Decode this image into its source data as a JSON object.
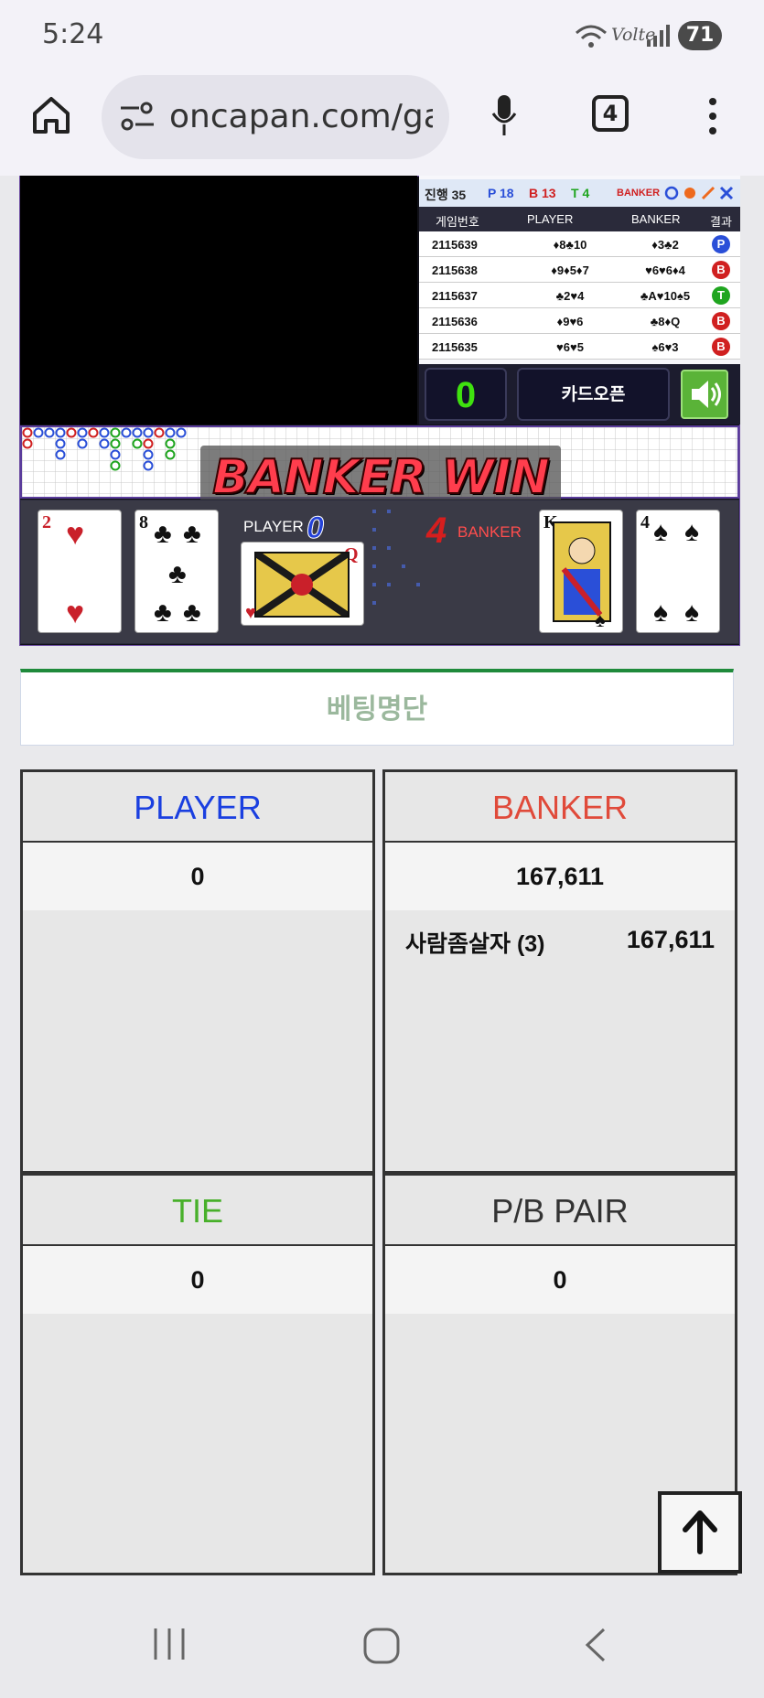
{
  "status_bar": {
    "time": "5:24",
    "network": "Volte",
    "battery": "71"
  },
  "browser": {
    "url": "oncapan.com/gar",
    "tab_count": "4"
  },
  "game": {
    "history_summary": {
      "progress": "진행 35",
      "player_count": "P 18",
      "banker_count": "B 13",
      "tie_count": "T 4",
      "banker_label": "BANKER"
    },
    "history_headers": {
      "game_no": "게임번호",
      "player": "PLAYER",
      "banker": "BANKER",
      "result": "결과"
    },
    "history_rows": [
      {
        "game_no": "2115639",
        "player": "♦8♣10",
        "banker": "♦3♣2",
        "result": "P",
        "result_color": "#2a4fd8"
      },
      {
        "game_no": "2115638",
        "player": "♦9♦5♦7",
        "banker": "♥6♥6♦4",
        "result": "B",
        "result_color": "#d02020"
      },
      {
        "game_no": "2115637",
        "player": "♣2♥4",
        "banker": "♣A♥10♠5",
        "result": "T",
        "result_color": "#1fa51f"
      },
      {
        "game_no": "2115636",
        "player": "♦9♥6",
        "banker": "♣8♦Q",
        "result": "B",
        "result_color": "#d02020"
      },
      {
        "game_no": "2115635",
        "player": "♥6♥5",
        "banker": "♠6♥3",
        "result": "B",
        "result_color": "#d02020"
      }
    ],
    "counter": "0",
    "card_open_label": "카드오픈",
    "banner": "BANKER WIN",
    "player_label": "PLAYER",
    "player_score": "0",
    "banker_label": "BANKER",
    "banker_score": "4",
    "player_cards": [
      {
        "rank": "2",
        "suit": "♥",
        "color": "#c9202a"
      },
      {
        "rank": "8",
        "suit": "♣",
        "color": "#111111"
      },
      {
        "rank": "Q",
        "suit": "♥",
        "color": "#c9202a"
      }
    ],
    "banker_cards": [
      {
        "rank": "K",
        "suit": "♠",
        "color": "#111111"
      },
      {
        "rank": "4",
        "suit": "♠",
        "color": "#111111"
      }
    ]
  },
  "betting": {
    "title": "베팅명단",
    "player": {
      "label": "PLAYER",
      "total": "0",
      "color": "#1a3fe0"
    },
    "banker": {
      "label": "BANKER",
      "total": "167,611",
      "color": "#e04a3a",
      "entries": [
        {
          "name": "사람좀살자 (3)",
          "amount": "167,611"
        }
      ]
    },
    "tie": {
      "label": "TIE",
      "total": "0",
      "color": "#48b02a"
    },
    "pair": {
      "label": "P/B PAIR",
      "total": "0",
      "color": "#333333"
    }
  }
}
